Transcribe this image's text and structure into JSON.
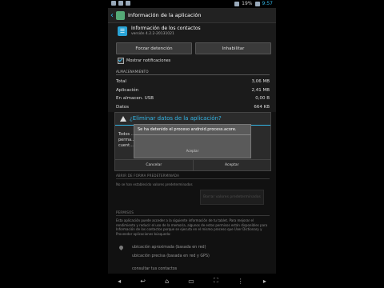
{
  "status": {
    "time": "9:57",
    "battery": "19%"
  },
  "actionbar": {
    "title": "Información de la aplicación"
  },
  "app": {
    "name": "Información de los contactos",
    "version": "versión 4.2.2-20131021"
  },
  "buttons": {
    "force_stop": "Forzar detención",
    "disable": "Inhabilitar"
  },
  "notifications": {
    "label": "Mostrar notificaciones"
  },
  "storage": {
    "header": "ALMACENAMIENTO",
    "rows": [
      {
        "label": "Total",
        "value": "3,06 MB"
      },
      {
        "label": "Aplicación",
        "value": "2,41 MB"
      },
      {
        "label": "En almacen. USB",
        "value": "0,00 B"
      },
      {
        "label": "Datos",
        "value": "664 KB"
      }
    ]
  },
  "dialog": {
    "title": "¿Eliminar datos de la aplicación?",
    "body": "Todos ... perma... cuent...",
    "cancel": "Cancelar",
    "accept": "Aceptar"
  },
  "toast": {
    "message": "Se ha detenido el proceso android.process.acore.",
    "ok": "Aceptar"
  },
  "defaults": {
    "header": "ABRIR DE FORMA PREDETERMINADA",
    "note": "No se han establecido valores predeterminados",
    "clear_button": "Borrar valores predeterminados"
  },
  "permissions": {
    "header": "PERMISOS",
    "text": "Esta aplicación puede acceder a la siguiente información de tu tablet. Para mejorar el rendimiento y reducir el uso de la memoria, algunos de estos permisos están disponibles para Información de los contactos porque se ejecuta en el mismo proceso que User Dictionary y Proveedor aplicaciones búsqueda:",
    "items": [
      "ubicación aproximada (basada en red)",
      "ubicación precisa (basada en red y GPS)",
      "consultar tus contactos"
    ]
  }
}
